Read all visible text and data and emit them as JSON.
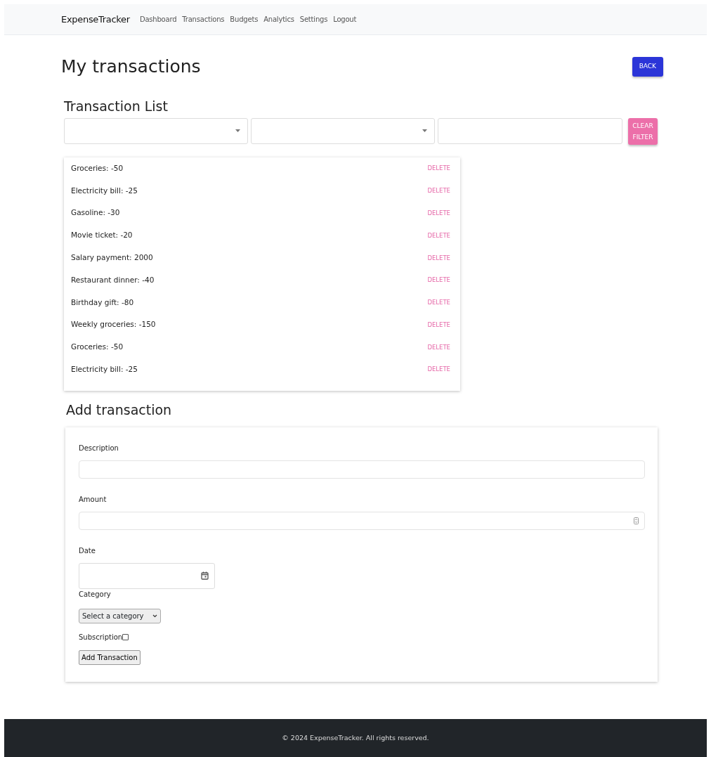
{
  "navbar": {
    "brand": "ExpenseTracker",
    "links": [
      "Dashboard",
      "Transactions",
      "Budgets",
      "Analytics",
      "Settings",
      "Logout"
    ]
  },
  "page_title": "My transactions",
  "back_button": "BACK",
  "list_heading": "Transaction List",
  "filters": [
    {
      "kind": "select"
    },
    {
      "kind": "select"
    },
    {
      "kind": "text"
    }
  ],
  "clear_filter_button": "CLEAR FILTER",
  "transactions": [
    {
      "label": "Groceries: -50",
      "action": "DELETE"
    },
    {
      "label": "Electricity bill: -25",
      "action": "DELETE"
    },
    {
      "label": "Gasoline: -30",
      "action": "DELETE"
    },
    {
      "label": "Movie ticket: -20",
      "action": "DELETE"
    },
    {
      "label": "Salary payment: 2000",
      "action": "DELETE"
    },
    {
      "label": "Restaurant dinner: -40",
      "action": "DELETE"
    },
    {
      "label": "Birthday gift: -80",
      "action": "DELETE"
    },
    {
      "label": "Weekly groceries: -150",
      "action": "DELETE"
    },
    {
      "label": "Groceries: -50",
      "action": "DELETE"
    },
    {
      "label": "Electricity bill: -25",
      "action": "DELETE"
    }
  ],
  "add_heading": "Add transaction",
  "form_fields": [
    {
      "kind": "text",
      "label": "Description"
    },
    {
      "kind": "number",
      "label": "Amount"
    },
    {
      "kind": "date",
      "label": "Date"
    },
    {
      "kind": "select",
      "label": "Category",
      "value": "Select a category"
    },
    {
      "kind": "checkbox",
      "label": "Subscription",
      "checked": false
    }
  ],
  "submit_button": "Add Transaction",
  "footer": "© 2024 ExpenseTracker. All rights reserved."
}
